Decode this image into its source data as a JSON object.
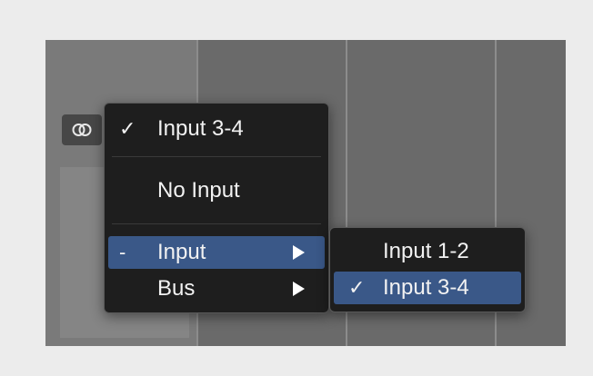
{
  "stereo_button": {
    "icon": "stereo-link-icon"
  },
  "input_menu": {
    "selected_label": "Input 3-4",
    "check_mark": "✓",
    "no_input_label": "No Input",
    "dash_mark": "-",
    "input_label": "Input",
    "bus_label": "Bus",
    "highlight_color": "#3a5888"
  },
  "input_submenu": {
    "items": [
      {
        "label": "Input 1-2",
        "checked": false
      },
      {
        "label": "Input 3-4",
        "checked": true
      }
    ],
    "check_mark": "✓"
  }
}
